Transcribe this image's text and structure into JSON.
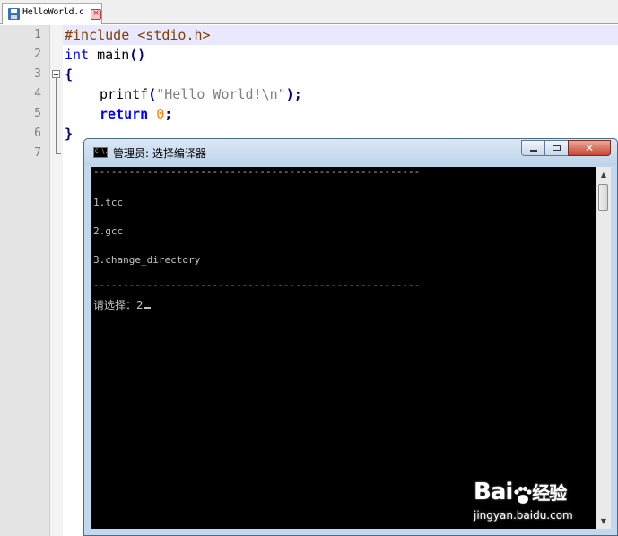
{
  "editor": {
    "tab": {
      "filename": "HelloWorld.c",
      "close_label": "×"
    },
    "line_numbers": [
      "1",
      "2",
      "3",
      "4",
      "5",
      "6",
      "7"
    ],
    "code": {
      "line1": {
        "directive": "#include <stdio.h>"
      },
      "line2": {
        "type": "int",
        "name": " main",
        "parens": "()"
      },
      "line3": {
        "brace": "{"
      },
      "line4": {
        "func": "printf",
        "open": "(",
        "string": "\"Hello World!\\n\"",
        "close": ");"
      },
      "line5": {
        "keyword": "return",
        "space": " ",
        "number": "0",
        "semi": ";"
      },
      "line6": {
        "brace": "}"
      }
    }
  },
  "console": {
    "title": "管理员: 选择编译器",
    "icon_text": "C:\\.",
    "close_label": "✕",
    "separator": "-------------------------------------------------------",
    "options": [
      "1.tcc",
      "2.gcc",
      "3.change_directory"
    ],
    "prompt": "请选择：2",
    "scroll_up": "▲",
    "scroll_down": "▼"
  },
  "watermark": {
    "logo_left": "Bai",
    "logo_right": "经验",
    "url": "jingyan.baidu.com"
  },
  "colors": {
    "preprocessor": "#804000",
    "keyword": "#0000ff",
    "string": "#808080",
    "number": "#ff8000",
    "current_line": "#e8e8ff",
    "console_bg": "#000000",
    "console_text": "#c0c0c0"
  }
}
